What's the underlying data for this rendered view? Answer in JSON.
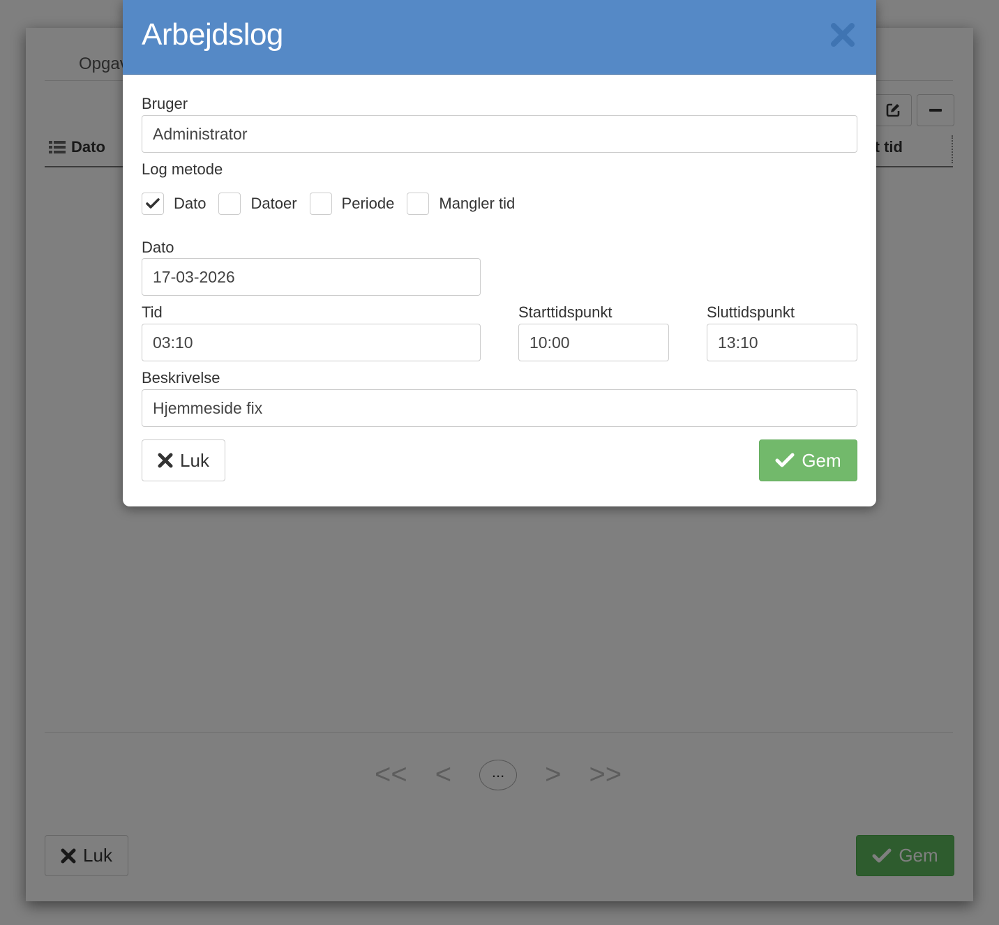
{
  "background": {
    "tab_label": "Opgav",
    "column_dato": "Dato",
    "column_tid": "t tid",
    "pager": {
      "first": "<<",
      "prev": "<",
      "ellipsis": "...",
      "next": ">",
      "last": ">>"
    },
    "close_label": "Luk",
    "save_label": "Gem"
  },
  "modal": {
    "title": "Arbejdslog",
    "user_label": "Bruger",
    "user_value": "Administrator",
    "log_method_label": "Log metode",
    "log_methods": [
      {
        "label": "Dato",
        "checked": true
      },
      {
        "label": "Datoer",
        "checked": false
      },
      {
        "label": "Periode",
        "checked": false
      },
      {
        "label": "Mangler tid",
        "checked": false
      }
    ],
    "date_label": "Dato",
    "date_value": "17-03-2026",
    "time_label": "Tid",
    "time_value": "03:10",
    "start_label": "Starttidspunkt",
    "start_value": "10:00",
    "end_label": "Sluttidspunkt",
    "end_value": "13:10",
    "description_label": "Beskrivelse",
    "description_value": "Hjemmeside fix",
    "close_label": "Luk",
    "save_label": "Gem"
  },
  "colors": {
    "header_blue": "#5589c6",
    "save_green": "#72b96b"
  }
}
